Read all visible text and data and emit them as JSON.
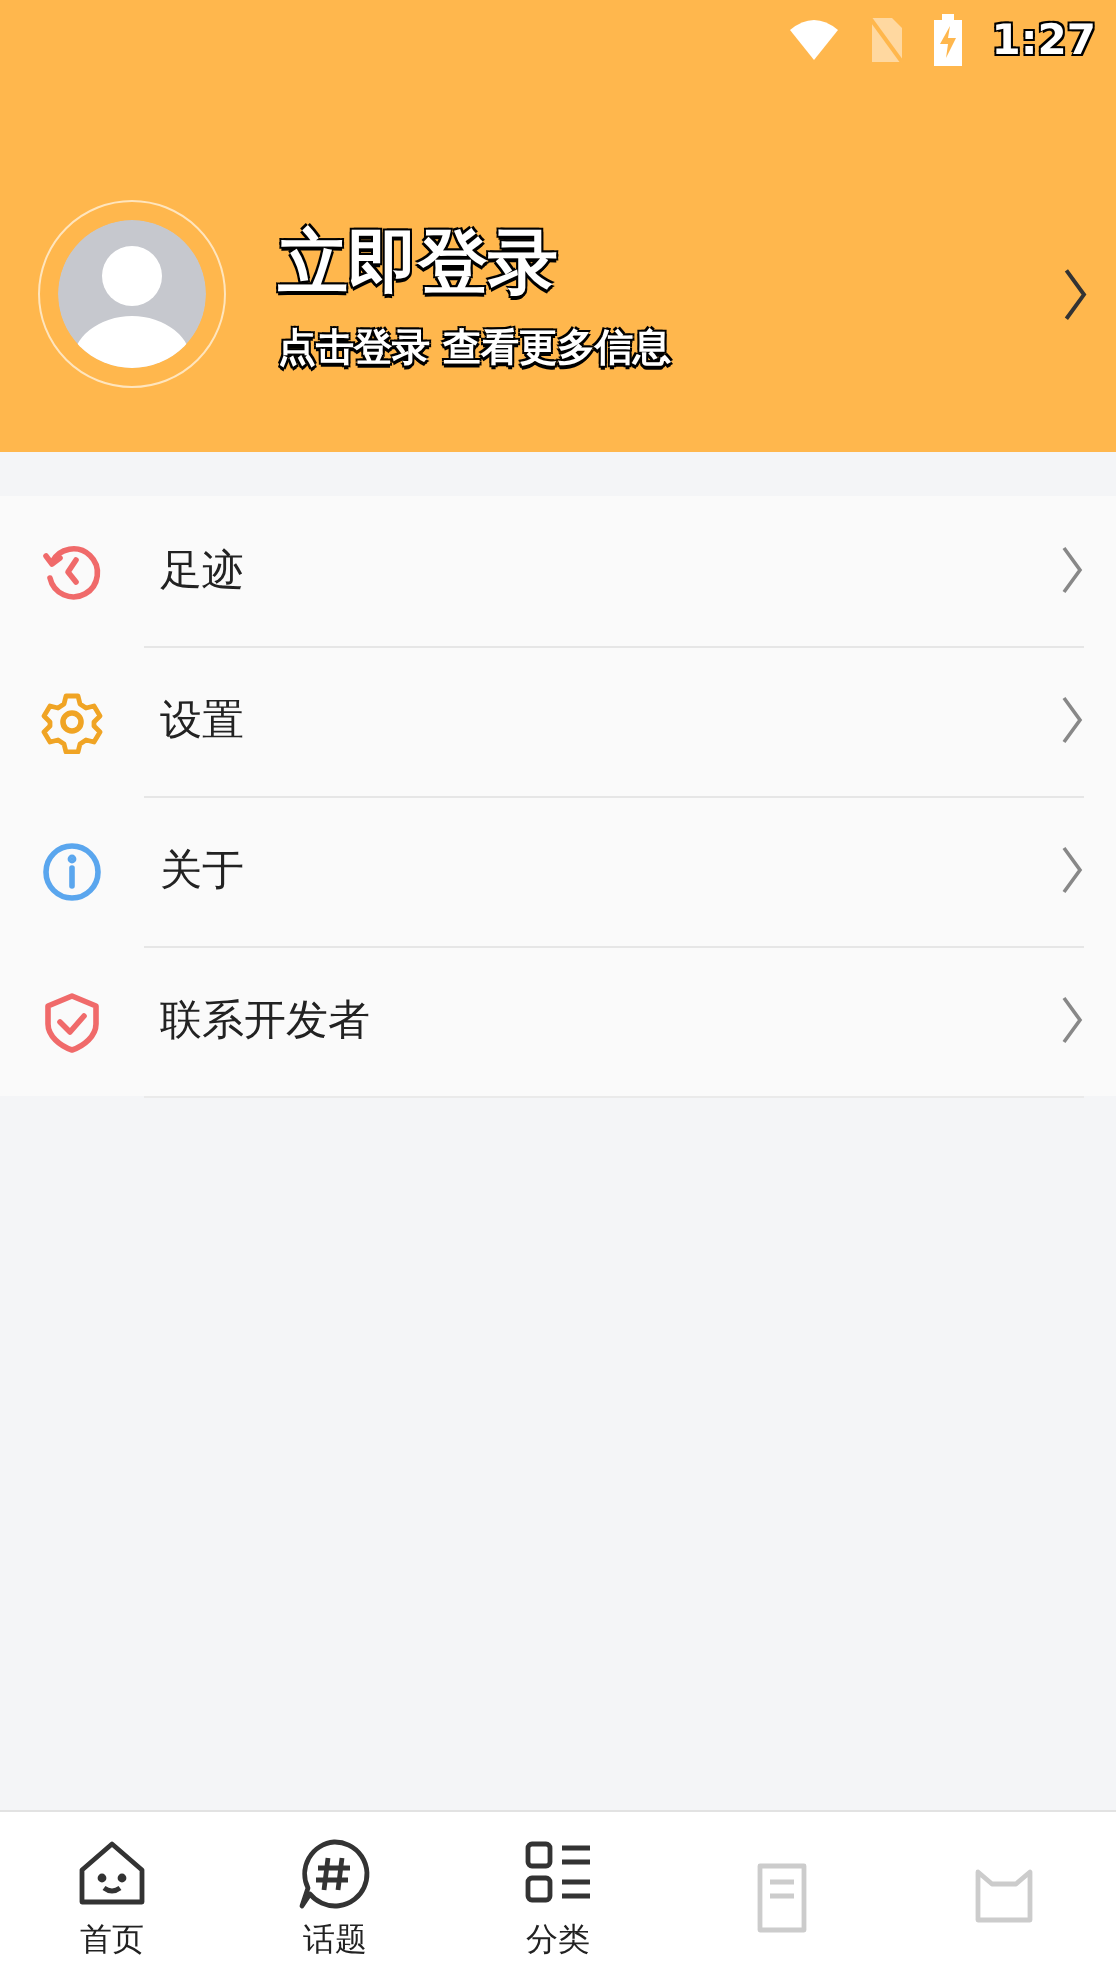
{
  "status_bar": {
    "time": "1:27"
  },
  "profile": {
    "title": "立即登录",
    "subtitle": "点击登录 查看更多信息"
  },
  "menu": [
    {
      "kind": "history",
      "label": "足迹",
      "color": "#f06a6a"
    },
    {
      "kind": "settings",
      "label": "设置",
      "color": "#f0a424"
    },
    {
      "kind": "info",
      "label": "关于",
      "color": "#5aa6ee"
    },
    {
      "kind": "shield",
      "label": "联系开发者",
      "color": "#f06a6a"
    }
  ],
  "bottom_nav": [
    {
      "kind": "home",
      "label": "首页"
    },
    {
      "kind": "topic",
      "label": "话题"
    },
    {
      "kind": "category",
      "label": "分类"
    },
    {
      "kind": "document"
    },
    {
      "kind": "cat"
    }
  ]
}
